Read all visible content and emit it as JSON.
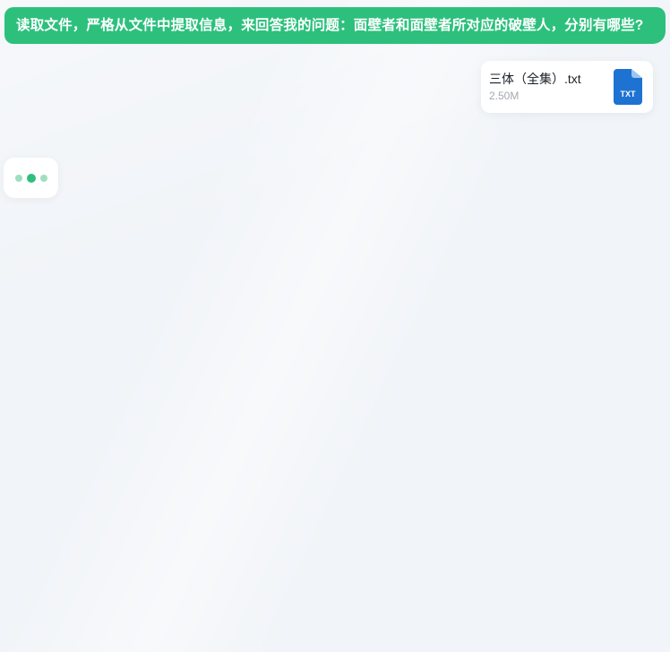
{
  "colors": {
    "page_bg": "#f1f4f8",
    "accent_green": "#2dc07d",
    "light_green_dot": "#9fdfc0",
    "card_bg": "#ffffff",
    "white": "#ffffff",
    "text_dark": "#1c2126",
    "text_gray": "#a3a9b0",
    "icon_blue": "#1e72d2",
    "icon_fold": "#9ec5ef"
  },
  "user_message": {
    "text": "读取文件，严格从文件中提取信息，来回答我的问题：面壁者和面壁者所对应的破壁人，分别有哪些?"
  },
  "attachment": {
    "file_name": "三体（全集）.txt",
    "file_size": "2.50M",
    "icon": "txt-file-icon",
    "icon_label": "TXT"
  },
  "assistant_typing": {
    "indicator": "typing-dots"
  }
}
